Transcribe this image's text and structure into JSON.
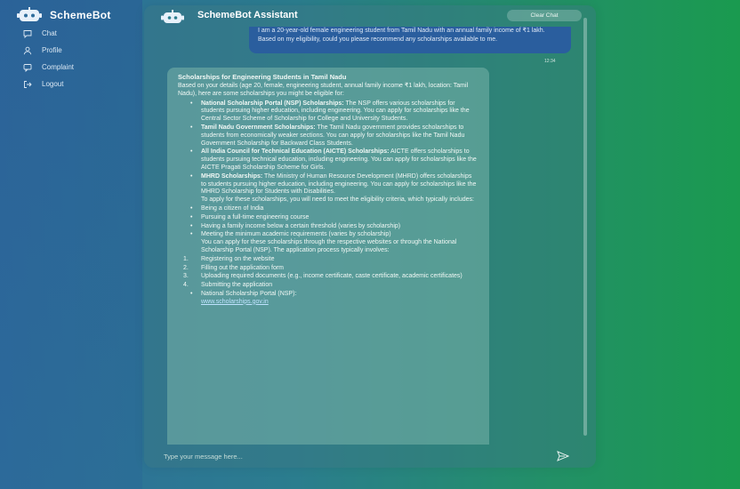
{
  "app": {
    "brand": "SchemeBot"
  },
  "sidebar": {
    "items": [
      {
        "label": "Chat",
        "icon": "chat-icon"
      },
      {
        "label": "Profile",
        "icon": "user-icon"
      },
      {
        "label": "Complaint",
        "icon": "message-icon"
      },
      {
        "label": "Logout",
        "icon": "logout-icon"
      }
    ]
  },
  "chat": {
    "title": "SchemeBot Assistant",
    "clear_label": "Clear Chat",
    "user_message": "I am a 20-year-old female engineering student from Tamil Nadu with an annual family income of ₹1 lakh. Based on my eligibility, could you please recommend any scholarships available to me.",
    "user_time": "12:34",
    "bot": {
      "heading": "Scholarships for Engineering Students in Tamil Nadu",
      "intro": "Based on your details (age 20, female, engineering student, annual family income ₹1 lakh, location: Tamil Nadu), here are some scholarships you might be eligible for:",
      "schemes": [
        {
          "name": "National Scholarship Portal (NSP) Scholarships:",
          "desc": " The NSP offers various scholarships for students pursuing higher education, including engineering. You can apply for scholarships like the Central Sector Scheme of Scholarship for College and University Students."
        },
        {
          "name": "Tamil Nadu Government Scholarships:",
          "desc": " The Tamil Nadu government provides scholarships to students from economically weaker sections. You can apply for scholarships like the Tamil Nadu Government Scholarship for Backward Class Students."
        },
        {
          "name": "All India Council for Technical Education (AICTE) Scholarships:",
          "desc": " AICTE offers scholarships to students pursuing technical education, including engineering. You can apply for scholarships like the AICTE Pragati Scholarship Scheme for Girls."
        },
        {
          "name": "MHRD Scholarships:",
          "desc": " The Ministry of Human Resource Development (MHRD) offers scholarships to students pursuing higher education, including engineering. You can apply for scholarships like the MHRD Scholarship for Students with Disabilities."
        }
      ],
      "criteria_intro": "To apply for these scholarships, you will need to meet the eligibility criteria, which typically includes:",
      "criteria": [
        "Being a citizen of India",
        "Pursuing a full-time engineering course",
        "Having a family income below a certain threshold (varies by scholarship)",
        "Meeting the minimum academic requirements (varies by scholarship)"
      ],
      "apply_intro": "You can apply for these scholarships through the respective websites or through the National Scholarship Portal (NSP). The application process typically involves:",
      "steps": [
        "Registering on the website",
        "Filling out the application form",
        "Uploading required documents (e.g., income certificate, caste certificate, academic certificates)",
        "Submitting the application"
      ],
      "link_label": "National Scholarship Portal (NSP):",
      "link_url": "www.scholarships.gov.in"
    },
    "input_placeholder": "Type your message here...",
    "send_icon": "send-icon"
  }
}
